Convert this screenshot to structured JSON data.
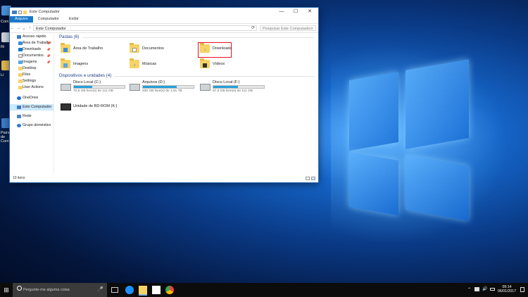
{
  "desktop": {
    "icons": [
      {
        "label": "Computador",
        "icon": "computer-icon"
      },
      {
        "label": "Ri",
        "icon": "recycle-bin-icon"
      },
      {
        "label": "Li",
        "icon": "library-icon"
      },
      {
        "label": "Painel de Controle",
        "icon": "control-panel-icon"
      }
    ]
  },
  "window": {
    "title": "Este Computador",
    "controls": {
      "minimize": "—",
      "maximize": "☐",
      "close": "✕"
    },
    "ribbon_tabs": [
      "Arquivo",
      "Computador",
      "Exibir"
    ],
    "nav": {
      "back": "←",
      "forward": "→",
      "recent": "⌄",
      "up": "↑"
    },
    "address": "Este Computador",
    "search_placeholder": "Pesquisar Este Computador",
    "sidebar": [
      {
        "label": "Acesso rápido",
        "icon": "star-icon",
        "pinned": false
      },
      {
        "label": "Área de Trabalho",
        "icon": "desktop-folder-icon",
        "pinned": true
      },
      {
        "label": "Downloads",
        "icon": "download-icon",
        "pinned": true
      },
      {
        "label": "Documentos",
        "icon": "documents-icon",
        "pinned": true
      },
      {
        "label": "Imagens",
        "icon": "pictures-icon",
        "pinned": true
      },
      {
        "label": "Desktop",
        "icon": "folder-icon",
        "pinned": false
      },
      {
        "label": "Files",
        "icon": "folder-icon",
        "pinned": false
      },
      {
        "label": "Settings",
        "icon": "folder-icon",
        "pinned": false
      },
      {
        "label": "User Actions",
        "icon": "folder-icon",
        "pinned": false
      },
      {
        "label": "OneDrive",
        "icon": "cloud-icon",
        "pinned": false
      },
      {
        "label": "Este Computador",
        "icon": "computer-icon",
        "pinned": false,
        "selected": true
      },
      {
        "label": "Rede",
        "icon": "network-icon",
        "pinned": false
      },
      {
        "label": "Grupo doméstico",
        "icon": "homegroup-icon",
        "pinned": false
      }
    ],
    "pin_glyph": "📌",
    "folders_header": "Pastas (6)",
    "folders": [
      {
        "label": "Área de Trabalho",
        "icon": "desktop-folder-icon"
      },
      {
        "label": "Documentos",
        "icon": "documents-folder-icon"
      },
      {
        "label": "Downloads",
        "icon": "downloads-folder-icon",
        "highlighted": true
      },
      {
        "label": "Imagens",
        "icon": "pictures-folder-icon"
      },
      {
        "label": "Músicas",
        "icon": "music-folder-icon"
      },
      {
        "label": "Vídeos",
        "icon": "videos-folder-icon"
      }
    ],
    "devices_header": "Dispositivos e unidades (4)",
    "drives": [
      {
        "name": "Disco Local (C:)",
        "free": "70,6 GB livre(s) de 111 GB",
        "used_fraction": 0.36
      },
      {
        "name": "Arquivos (D:)",
        "free": "630 GB livre(s) de 1,81 TB",
        "used_fraction": 0.66
      },
      {
        "name": "Disco Local (F:)",
        "free": "57,0 GB livre(s) de 111 GB",
        "used_fraction": 0.49
      }
    ],
    "optical": {
      "name": "Unidade de BD-ROM (K:)"
    },
    "status": "10 itens"
  },
  "taskbar": {
    "start_glyph": "⊞",
    "search_placeholder": "Pergunte-me alguma coisa",
    "mic_glyph": "🎤",
    "pinned": [
      "task-view-icon",
      "edge-icon",
      "file-explorer-icon",
      "store-icon",
      "chrome-icon"
    ],
    "time": "09:14",
    "date": "06/01/2017"
  },
  "colors": {
    "accent": "#1979ca",
    "highlight": "#e81123",
    "drive_fill": "#26a0da"
  }
}
